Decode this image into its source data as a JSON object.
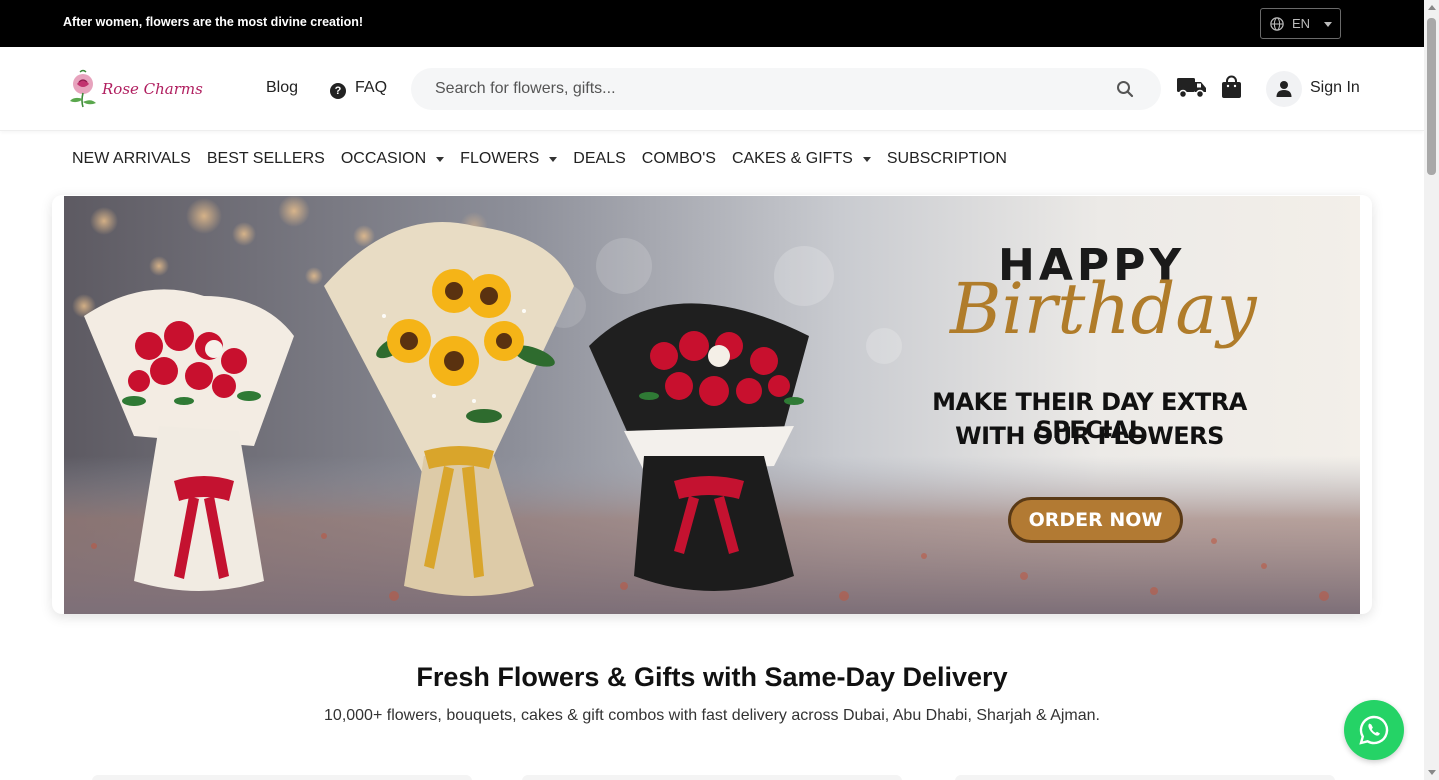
{
  "topbar": {
    "tagline": "After women, flowers are the most divine creation!",
    "language": "EN"
  },
  "header": {
    "logo_text": "Rose Charms",
    "blog": "Blog",
    "faq": "FAQ",
    "search_placeholder": "Search for flowers, gifts...",
    "sign_in": "Sign In"
  },
  "nav": {
    "items": [
      "NEW ARRIVALS",
      "BEST SELLERS",
      "OCCASION",
      "FLOWERS",
      "DEALS",
      "COMBO'S",
      "CAKES & GIFTS",
      "SUBSCRIPTION"
    ]
  },
  "banner": {
    "happy": "HAPPY",
    "birthday": "Birthday",
    "line1": "MAKE THEIR DAY EXTRA SPECIAL",
    "line2": "WITH OUR FLOWERS",
    "cta": "ORDER NOW"
  },
  "section": {
    "title": "Fresh Flowers & Gifts with Same-Day Delivery",
    "subtitle": "10,000+ flowers, bouquets, cakes & gift combos with fast delivery across Dubai, Abu Dhabi, Sharjah & Ajman."
  },
  "colors": {
    "topbar_bg": "#000000",
    "brand": "#b01e5f",
    "gold": "#b07c2a",
    "whatsapp": "#25d366"
  }
}
